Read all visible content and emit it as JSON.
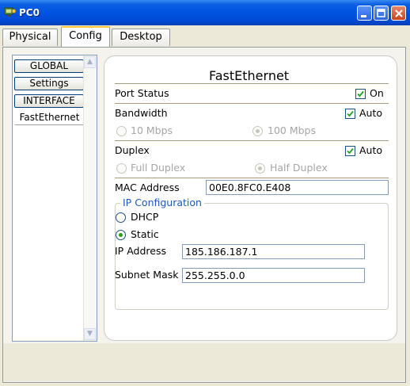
{
  "window": {
    "title": "PC0"
  },
  "tabs": [
    {
      "label": "Physical"
    },
    {
      "label": "Config"
    },
    {
      "label": "Desktop"
    }
  ],
  "sidebar": {
    "items": [
      {
        "label": "GLOBAL"
      },
      {
        "label": "Settings"
      },
      {
        "label": "INTERFACE"
      },
      {
        "label": "FastEthernet"
      }
    ]
  },
  "interface": {
    "heading": "FastEthernet",
    "port_status": {
      "label": "Port Status",
      "checkbox_label": "On",
      "checked": true
    },
    "bandwidth": {
      "label": "Bandwidth",
      "auto_label": "Auto",
      "auto_checked": true,
      "option_10": "10 Mbps",
      "option_100": "100 Mbps",
      "selected": "100 Mbps"
    },
    "duplex": {
      "label": "Duplex",
      "auto_label": "Auto",
      "auto_checked": true,
      "option_full": "Full Duplex",
      "option_half": "Half Duplex",
      "selected": "Half Duplex"
    },
    "mac": {
      "label": "MAC Address",
      "value": "00E0.8FC0.E408"
    },
    "ip_config": {
      "legend": "IP Configuration",
      "dhcp_label": "DHCP",
      "static_label": "Static",
      "selected": "Static",
      "ip_label": "IP Address",
      "ip_value": "185.186.187.1",
      "mask_label": "Subnet Mask",
      "mask_value": "255.255.0.0"
    }
  },
  "colors": {
    "titlebar": "#0054e3",
    "active_tab_accent": "#ffc83c",
    "checkmark": "#21a121",
    "legend_text": "#1d5ab5"
  }
}
